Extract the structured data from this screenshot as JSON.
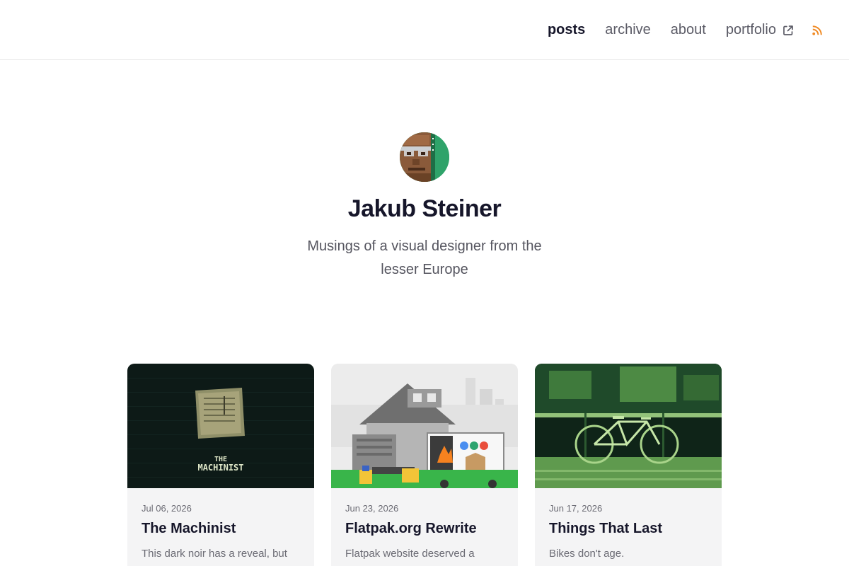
{
  "nav": {
    "items": [
      {
        "label": "posts",
        "active": true
      },
      {
        "label": "archive",
        "active": false
      },
      {
        "label": "about",
        "active": false
      },
      {
        "label": "portfolio",
        "active": false,
        "external": true
      }
    ],
    "external_icon": "external-link-icon",
    "rss_icon": "rss-icon",
    "rss_color": "#f08a24"
  },
  "hero": {
    "avatar_icon": "pixel-portrait-avatar",
    "name": "Jakub Steiner",
    "tagline": "Musings of a visual designer from the lesser Europe"
  },
  "posts": [
    {
      "date": "Jul 06, 2026",
      "title": "The Machinist",
      "excerpt": "This dark noir has a reveal, but the one that it is compromise",
      "thumb_text": [
        "THE",
        "MACHINIST"
      ]
    },
    {
      "date": "Jun 23, 2026",
      "title": "Flatpak.org Rewrite",
      "excerpt": "Flatpak website deserved a better landscape",
      "thumb_text": []
    },
    {
      "date": "Jun 17, 2026",
      "title": "Things That Last",
      "excerpt": "Bikes don't age.",
      "thumb_text": []
    }
  ],
  "colors": {
    "accent": "#f08a24",
    "text_dark": "#16162a",
    "text_muted": "#6b6b74",
    "card_bg": "#f4f4f5",
    "avatar_bg": "#2fa36a"
  }
}
